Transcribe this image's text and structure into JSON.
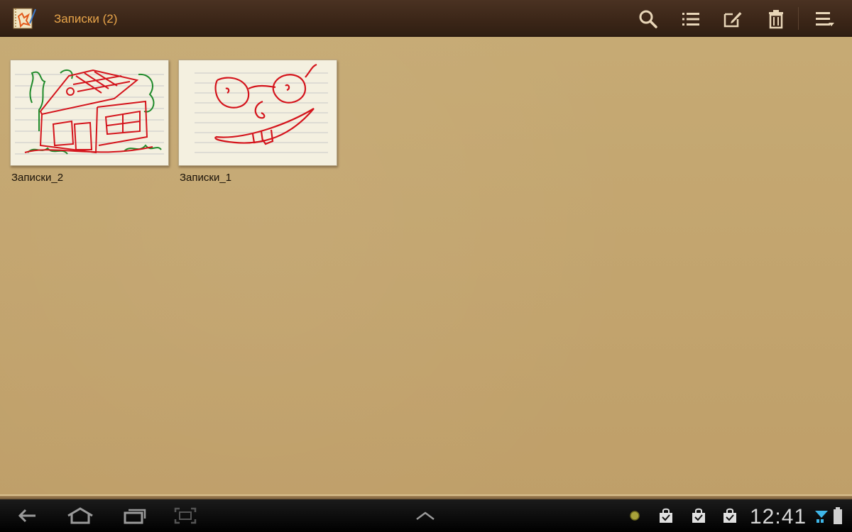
{
  "header": {
    "title": "Записки (2)",
    "icons": [
      "app-notebook-icon",
      "search-icon",
      "list-icon",
      "edit-icon",
      "delete-icon",
      "menu-icon"
    ]
  },
  "notes": [
    {
      "label": "Записки_2",
      "drawing": "house"
    },
    {
      "label": "Записки_1",
      "drawing": "face"
    }
  ],
  "status_bar": {
    "time": "12:41",
    "icons": [
      "back-icon",
      "home-icon",
      "recent-apps-icon",
      "screenshot-icon",
      "expand-up-icon",
      "notification-dot-icon",
      "shopping-bag-icon",
      "shopping-bag-icon",
      "shopping-bag-icon",
      "wifi-icon",
      "battery-icon"
    ]
  },
  "colors": {
    "header_bg": "#3a2517",
    "title": "#e8a54a",
    "workspace_bg": "#c2a56f",
    "ink_red": "#d4141c",
    "ink_green": "#1f8a2a"
  }
}
